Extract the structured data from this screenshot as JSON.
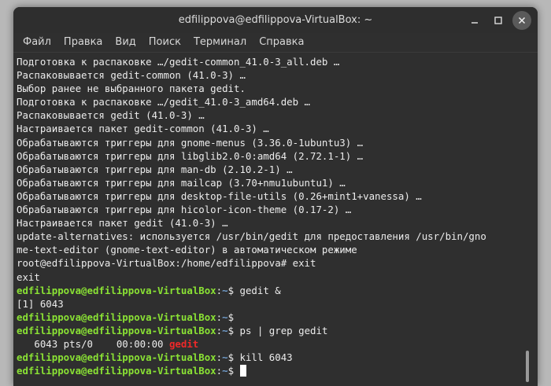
{
  "window": {
    "title": "edfilippova@edfilippova-VirtualBox: ~"
  },
  "menu": {
    "items": [
      "Файл",
      "Правка",
      "Вид",
      "Поиск",
      "Терминал",
      "Справка"
    ]
  },
  "terminal": {
    "output": [
      "Подготовка к распаковке …/gedit-common_41.0-3_all.deb …",
      "Распаковывается gedit-common (41.0-3) …",
      "Выбор ранее не выбранного пакета gedit.",
      "Подготовка к распаковке …/gedit_41.0-3_amd64.deb …",
      "Распаковывается gedit (41.0-3) …",
      "Настраивается пакет gedit-common (41.0-3) …",
      "Обрабатываются триггеры для gnome-menus (3.36.0-1ubuntu3) …",
      "Обрабатываются триггеры для libglib2.0-0:amd64 (2.72.1-1) …",
      "Обрабатываются триггеры для man-db (2.10.2-1) …",
      "Обрабатываются триггеры для mailcap (3.70+nmu1ubuntu1) …",
      "Обрабатываются триггеры для desktop-file-utils (0.26+mint1+vanessa) …",
      "Обрабатываются триггеры для hicolor-icon-theme (0.17-2) …",
      "Настраивается пакет gedit (41.0-3) …",
      "update-alternatives: используется /usr/bin/gedit для предоставления /usr/bin/gno",
      "me-text-editor (gnome-text-editor) в автоматическом режиме",
      "root@edfilippova-VirtualBox:/home/edfilippova# exit",
      "exit"
    ],
    "prompt": {
      "user_host": "edfilippova@edfilippova-VirtualBox",
      "colon": ":",
      "path": "~",
      "dollar": "$"
    },
    "session": [
      {
        "command": " gedit &"
      },
      {
        "output": "[1] 6043"
      },
      {
        "command": ""
      },
      {
        "command": " ps | grep gedit"
      },
      {
        "ps_prefix": "   6043 pts/0    00:00:00 ",
        "ps_match": "gedit"
      },
      {
        "command": " kill 6043"
      },
      {
        "command": " ",
        "cursor": true
      }
    ]
  },
  "colors": {
    "background": "#2f2f2f",
    "text": "#ececec",
    "prompt_user": "#8ae234",
    "prompt_path": "#729fcf",
    "grep_match": "#ef2929"
  },
  "icons": {
    "minimize": "minimize-icon",
    "maximize": "maximize-icon",
    "close": "close-icon"
  }
}
